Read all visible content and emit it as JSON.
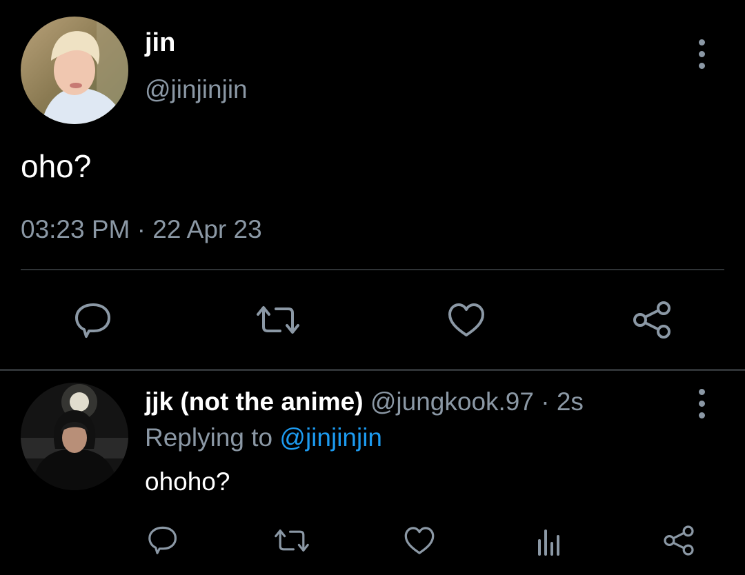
{
  "tweet": {
    "author_name": "jin",
    "author_handle": "@jinjinjin",
    "text": "oho?",
    "timestamp": "03:23 PM · 22 Apr 23",
    "actions": [
      "reply-icon",
      "retweet-icon",
      "like-icon",
      "share-icon"
    ]
  },
  "reply": {
    "author_name": "jjk (not the anime)",
    "author_handle": "@jungkook.97",
    "separator": "·",
    "time": "2s",
    "replying_prefix": "Replying to",
    "replying_mention": "@jinjinjin",
    "text": "ohoho?",
    "actions": [
      "reply-icon",
      "retweet-icon",
      "like-icon",
      "views-icon",
      "share-icon"
    ]
  },
  "colors": {
    "background": "#000000",
    "primary_text": "#ffffff",
    "secondary_text": "#8b98a5",
    "accent": "#1d9bf0",
    "divider": "#2f3336"
  }
}
